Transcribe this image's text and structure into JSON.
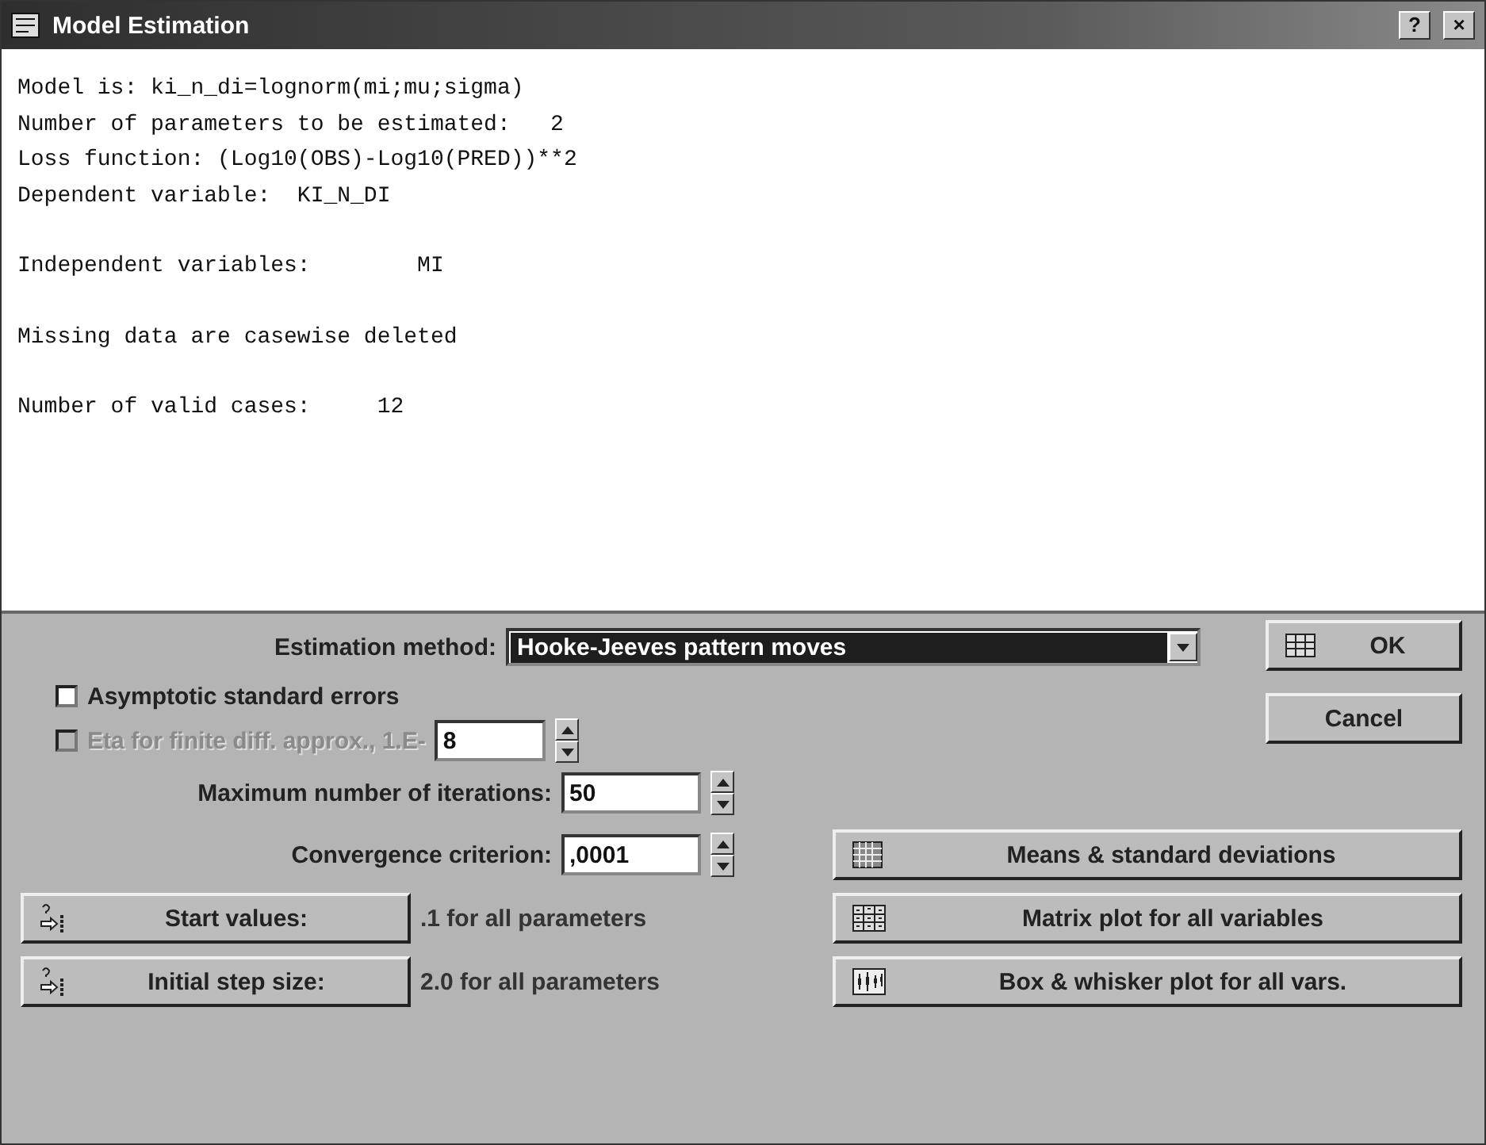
{
  "window": {
    "title": "Model Estimation",
    "help_button": "?",
    "close_button": "×"
  },
  "output": {
    "paragraphs": [
      [
        "Model is: ki_n_di=lognorm(mi;mu;sigma)",
        "Number of parameters to be estimated:   2",
        "Loss function: (Log10(OBS)-Log10(PRED))**2",
        "Dependent variable:  KI_N_DI"
      ],
      [
        "Independent variables:        MI"
      ],
      [
        "Missing data are casewise deleted"
      ],
      [
        "Number of valid cases:     12"
      ]
    ]
  },
  "estimation_method": {
    "label": "Estimation method:",
    "value": "Hooke-Jeeves pattern moves"
  },
  "checkboxes": [
    {
      "label": "Asymptotic standard errors",
      "checked": false,
      "disabled": false
    },
    {
      "label": "Eta for finite diff. approx., 1.E-",
      "checked": false,
      "disabled": true,
      "value": "8"
    }
  ],
  "spin_fields": [
    {
      "label": "Maximum number of iterations:",
      "value": "50"
    },
    {
      "label": "Convergence criterion:",
      "value": ",0001"
    }
  ],
  "parameter_buttons": [
    {
      "label": "Start values:",
      "note": ".1 for all parameters"
    },
    {
      "label": "Initial step size:",
      "note": "2.0 for all parameters"
    }
  ],
  "dialog_buttons": [
    {
      "label": "OK",
      "kind": "ok"
    },
    {
      "label": "Cancel",
      "kind": "plain"
    }
  ],
  "action_buttons": [
    {
      "label": "Means & standard deviations",
      "kind": "means"
    },
    {
      "label": "Matrix plot for all variables",
      "kind": "matrix"
    },
    {
      "label": "Box & whisker plot for all vars.",
      "kind": "box"
    }
  ]
}
